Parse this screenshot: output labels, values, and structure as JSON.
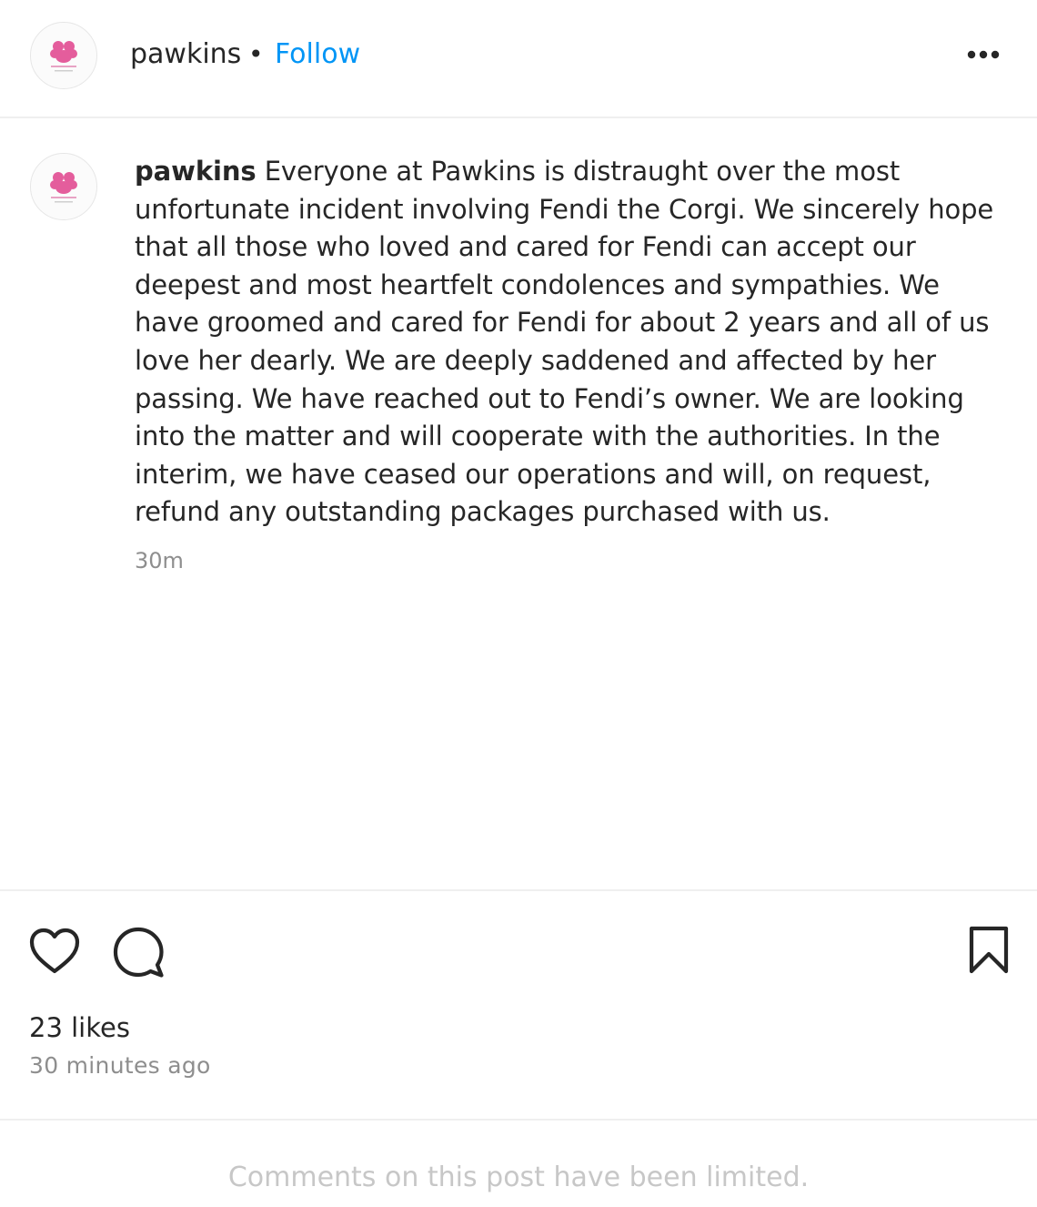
{
  "header": {
    "username": "pawkins",
    "separator": "•",
    "follow_label": "Follow",
    "more_icon": "more-horizontal-icon"
  },
  "caption": {
    "username": "pawkins",
    "text": "Everyone at Pawkins is distraught over the most unfortunate incident involving Fendi the Corgi. We sincerely hope that all those who loved and cared for Fendi can accept our deepest and most heartfelt condolences and sympathies. We have groomed and cared for Fendi for about 2 years and all of us love her dearly. We are deeply saddened and affected by her passing. We have reached out to Fendi’s owner. We are looking into the matter and will cooperate with the authorities. In the interim, we have ceased our operations and will, on request, refund any outstanding packages purchased with us.",
    "time": "30m"
  },
  "actions": {
    "like_icon": "heart-icon",
    "comment_icon": "comment-icon",
    "save_icon": "bookmark-icon"
  },
  "likes": "23 likes",
  "time_ago": "30 minutes ago",
  "comments_notice": "Comments on this post have been limited.",
  "colors": {
    "link": "#0095f6",
    "text": "#262626",
    "muted": "#8e8e8e",
    "faint": "#c7c7c7",
    "divider": "#efefef",
    "logo_pink": "#e0418b"
  }
}
